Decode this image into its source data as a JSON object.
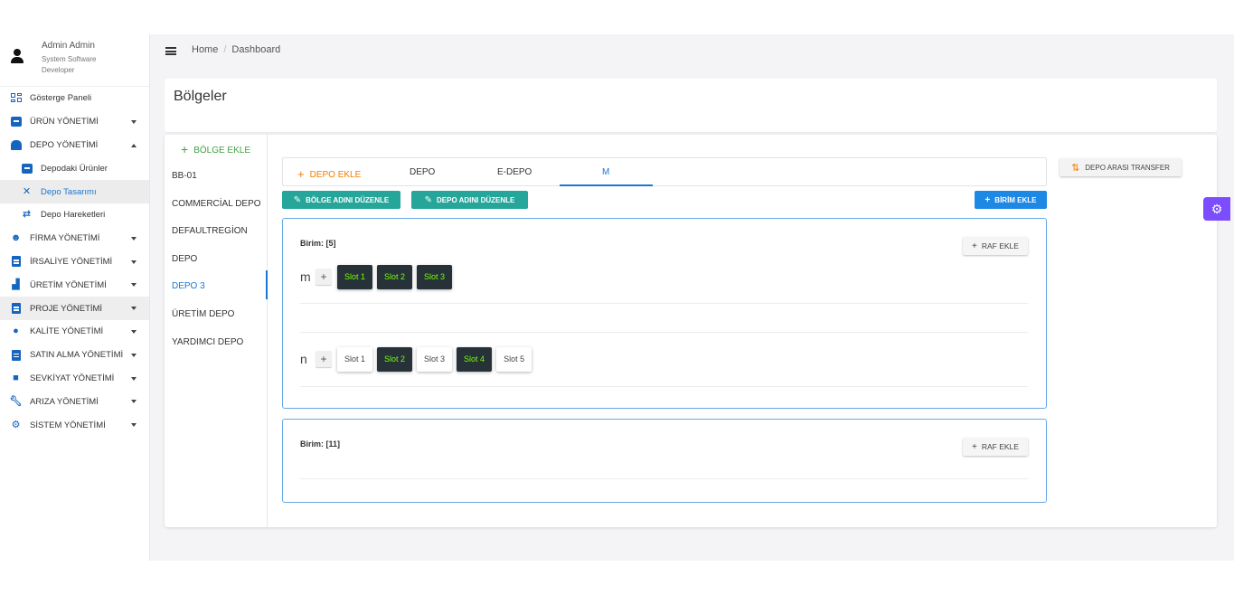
{
  "user": {
    "name": "Admin Admin",
    "role": "System Software Developer"
  },
  "sidebar": {
    "items": [
      {
        "label": "Gösterge Paneli",
        "icon": "dashboard-grid-icon"
      },
      {
        "label": "ÜRÜN YÖNETİMİ",
        "icon": "archive-box-icon"
      },
      {
        "label": "DEPO YÖNETİMİ",
        "icon": "warehouse-icon",
        "expanded": true
      },
      {
        "label": "Depodaki Ürünler",
        "icon": "archive-box-icon"
      },
      {
        "label": "Depo Tasarımı",
        "icon": "tools-icon",
        "active": true
      },
      {
        "label": "Depo Hareketleri",
        "icon": "swap-arrows-icon"
      },
      {
        "label": "FİRMA YÖNETİMİ",
        "icon": "users-cog-icon"
      },
      {
        "label": "İRSALİYE YÖNETİMİ",
        "icon": "clipboard-icon"
      },
      {
        "label": "ÜRETİM YÖNETİMİ",
        "icon": "factory-icon"
      },
      {
        "label": "PROJE YÖNETİMİ",
        "icon": "clipboard-icon"
      },
      {
        "label": "KALİTE YÖNETİMİ",
        "icon": "quality-icon"
      },
      {
        "label": "SATIN ALMA YÖNETİMİ",
        "icon": "invoice-icon"
      },
      {
        "label": "SEVKİYAT YÖNETİMİ",
        "icon": "truck-icon"
      },
      {
        "label": "ARIZA YÖNETİMİ",
        "icon": "wrench-icon"
      },
      {
        "label": "SİSTEM YÖNETİMİ",
        "icon": "gear-icon"
      }
    ]
  },
  "breadcrumb": {
    "home": "Home",
    "sep": "/",
    "current": "Dashboard"
  },
  "page": {
    "title": "Bölgeler"
  },
  "regions": {
    "add_label": "BÖLGE EKLE",
    "items": [
      "BB-01",
      "COMMERCİAL DEPO",
      "DEFAULTREGİON",
      "DEPO",
      "DEPO 3",
      "ÜRETİM DEPO",
      "YARDIMCI DEPO"
    ],
    "active": "DEPO 3"
  },
  "tabs": {
    "add_label": "DEPO EKLE",
    "items": [
      "DEPO",
      "E-DEPO",
      "M"
    ],
    "active": "M"
  },
  "actions": {
    "edit_region": "BÖLGE ADINI DÜZENLE",
    "edit_depot": "DEPO ADINI DÜZENLE",
    "add_unit": "BİRİM EKLE",
    "transfer": "DEPO ARASI TRANSFER",
    "add_shelf": "RAF EKLE",
    "add_slot_symbol": "+"
  },
  "units": [
    {
      "title": "Birim: [5]",
      "shelves": [
        {
          "name": "m",
          "slots": [
            {
              "label": "Slot 1",
              "filled": true
            },
            {
              "label": "Slot 2",
              "filled": true
            },
            {
              "label": "Slot 3",
              "filled": true
            }
          ]
        },
        {
          "name": "n",
          "slots": [
            {
              "label": "Slot 1",
              "filled": false
            },
            {
              "label": "Slot 2",
              "filled": true
            },
            {
              "label": "Slot 3",
              "filled": false
            },
            {
              "label": "Slot 4",
              "filled": true
            },
            {
              "label": "Slot 5",
              "filled": false
            }
          ]
        }
      ]
    },
    {
      "title": "Birim: [11]",
      "shelves": []
    }
  ],
  "colors": {
    "primary": "#1976d2",
    "teal": "#26a69a",
    "orange": "#f57c00",
    "green": "#43a047",
    "slot_filled_bg": "#263238",
    "slot_filled_text": "#76ff03",
    "fab": "#7c4dff"
  }
}
